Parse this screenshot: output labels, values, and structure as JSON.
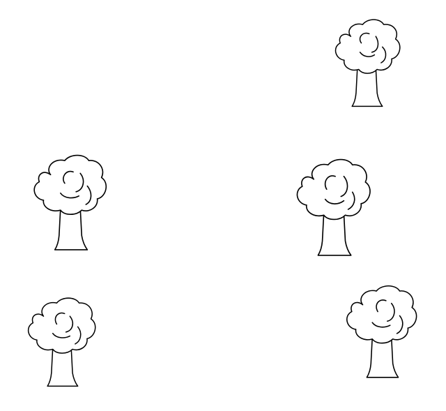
{
  "scene": {
    "background_color": "#ffffff",
    "line_color": "#000000",
    "tree_count": 5,
    "trees": [
      {
        "icon": "tree-icon"
      },
      {
        "icon": "tree-icon"
      },
      {
        "icon": "tree-icon"
      },
      {
        "icon": "tree-icon"
      },
      {
        "icon": "tree-icon"
      }
    ]
  }
}
